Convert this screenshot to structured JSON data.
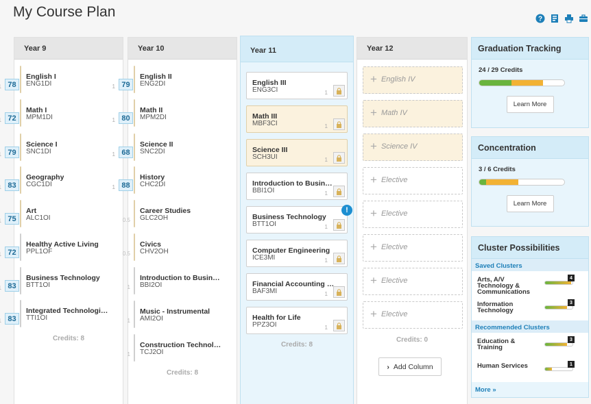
{
  "page_title": "My Course Plan",
  "top_icons": [
    "help-icon",
    "report-icon",
    "print-icon",
    "briefcase-icon"
  ],
  "years": [
    {
      "label": "Year 9",
      "credits": "Credits: 8",
      "courses": [
        {
          "name": "English I",
          "code": "ENG1DI",
          "credit": "1",
          "grade": "78"
        },
        {
          "name": "Math I",
          "code": "MPM1DI",
          "credit": "1",
          "grade": "72"
        },
        {
          "name": "Science I",
          "code": "SNC1DI",
          "credit": "1",
          "grade": "79"
        },
        {
          "name": "Geography",
          "code": "CGC1DI",
          "credit": "1",
          "grade": "83"
        },
        {
          "name": "Art",
          "code": "ALC1OI",
          "credit": "1",
          "grade": "75"
        },
        {
          "name": "Healthy Active Living",
          "code": "PPL1OF",
          "credit": "1",
          "grade": "72"
        },
        {
          "name": "Business Technology",
          "code": "BTT1OI",
          "credit": "1",
          "grade": "83"
        },
        {
          "name": "Integrated Technologies",
          "code": "TTI1OI",
          "credit": "1",
          "grade": "83"
        }
      ]
    },
    {
      "label": "Year 10",
      "credits": "Credits: 8",
      "courses": [
        {
          "name": "English II",
          "code": "ENG2DI",
          "credit": "1",
          "grade": "79"
        },
        {
          "name": "Math II",
          "code": "MPM2DI",
          "credit": "1",
          "grade": "80"
        },
        {
          "name": "Science II",
          "code": "SNC2DI",
          "credit": "1",
          "grade": "68"
        },
        {
          "name": "History",
          "code": "CHC2DI",
          "credit": "1",
          "grade": "88"
        },
        {
          "name": "Career Studies",
          "code": "GLC2OH",
          "credit": "0.5",
          "grade": ""
        },
        {
          "name": "Civics",
          "code": "CHV2OH",
          "credit": "0.5",
          "grade": ""
        },
        {
          "name": "Introduction to Busine...",
          "code": "BBI2OI",
          "credit": "1",
          "grade": ""
        },
        {
          "name": "Music - Instrumental",
          "code": "AMI2OI",
          "credit": "1",
          "grade": ""
        },
        {
          "name": "Construction Technology",
          "code": "TCJ2OI",
          "credit": "1",
          "grade": ""
        }
      ]
    },
    {
      "label": "Year 11",
      "credits": "Credits: 8",
      "courses": [
        {
          "name": "English III",
          "code": "ENG3CI",
          "credit": "1"
        },
        {
          "name": "Math III",
          "code": "MBF3CI",
          "credit": "1"
        },
        {
          "name": "Science III",
          "code": "SCH3UI",
          "credit": "1"
        },
        {
          "name": "Introduction to Business",
          "code": "BBI1OI",
          "credit": "1"
        },
        {
          "name": "Business Technology",
          "code": "BTT1OI",
          "credit": "1"
        },
        {
          "name": "Computer Engineering",
          "code": "ICE3MI",
          "credit": "1"
        },
        {
          "name": "Financial Accounting F...",
          "code": "BAF3MI",
          "credit": "1"
        },
        {
          "name": "Health for Life",
          "code": "PPZ3OI",
          "credit": "1"
        }
      ]
    },
    {
      "label": "Year 12",
      "credits": "Credits: 0",
      "placeholders": [
        "English IV",
        "Math IV",
        "Science IV",
        "Elective",
        "Elective",
        "Elective",
        "Elective",
        "Elective"
      ]
    }
  ],
  "add_column_label": "Add Column",
  "graduation": {
    "title": "Graduation Tracking",
    "credits": "24 / 29 Credits",
    "green_fraction": 0.5,
    "orange_fraction": 0.5,
    "learn_more": "Learn More"
  },
  "concentration": {
    "title": "Concentration",
    "credits": "3 / 6 Credits",
    "green_fraction": 0.2,
    "orange_fraction": 0.42,
    "learn_more": "Learn More"
  },
  "clusters": {
    "title": "Cluster Possibilities",
    "saved_label": "Saved Clusters",
    "saved": [
      {
        "name": "Arts, A/V Technology & Communications",
        "count": "4",
        "fraction": 0.95
      },
      {
        "name": "Information Technology",
        "count": "3",
        "fraction": 0.8
      }
    ],
    "recommended_label": "Recommended Clusters",
    "recommended": [
      {
        "name": "Education & Training",
        "count": "3",
        "fraction": 0.8
      },
      {
        "name": "Human Services",
        "count": "1",
        "fraction": 0.25
      }
    ],
    "more": "More »"
  },
  "colors": {
    "accent": "#1d7fb8",
    "green": "#6ab43e",
    "orange": "#f2b234",
    "card_tan": "#fbf2de"
  }
}
